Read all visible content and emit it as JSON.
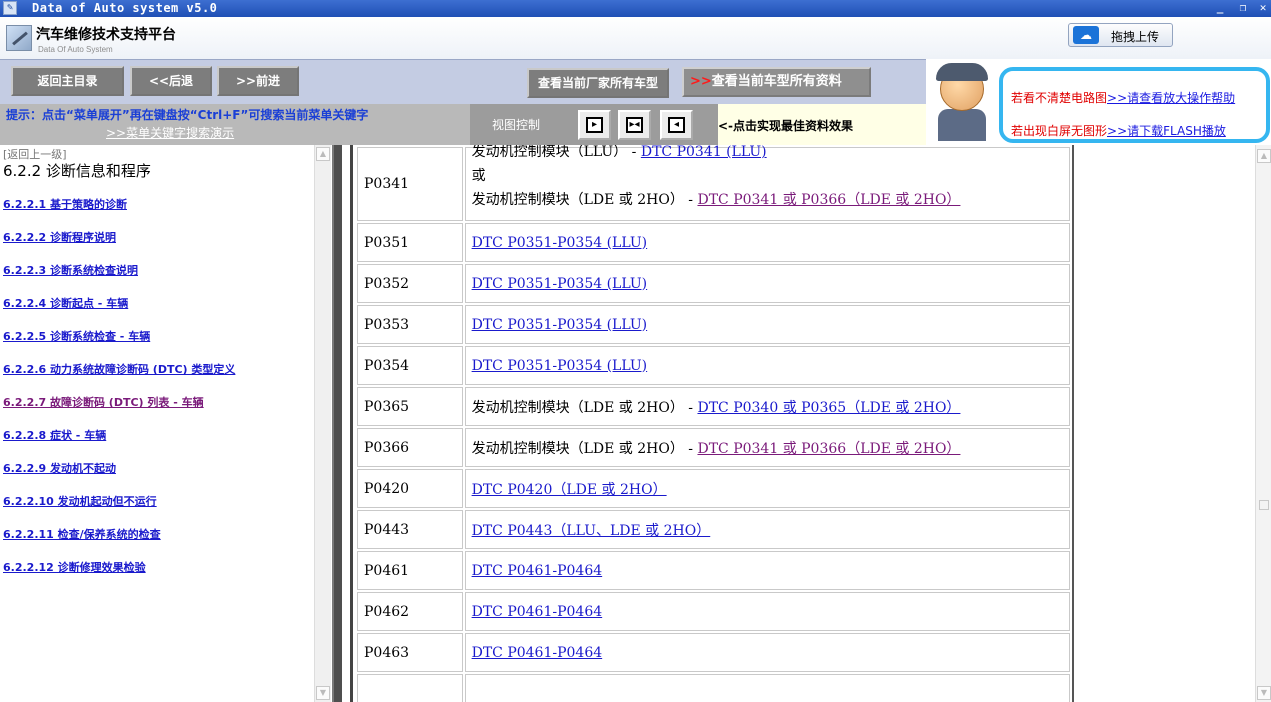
{
  "window": {
    "title": "Data of Auto system v5.0"
  },
  "header": {
    "brand": "汽车维修技术支持平台",
    "subtitle": "Data Of Auto System",
    "upload_label": "拖拽上传"
  },
  "nav": {
    "home": "返回主目录",
    "back": "<<后退",
    "forward": ">>前进",
    "maker_models": "查看当前厂家所有车型",
    "model_all_prefix": ">>",
    "model_all": "查看当前车型所有资料",
    "hint": "提示：点击“菜单展开”再在键盘按“Ctrl+F”可搜索当前菜单关键字",
    "hint_link": ">>菜单关键字搜索演示",
    "view_control": "视图控制",
    "best_tip": "<-点击实现最佳资料效果",
    "help1_text": "若看不清楚电路图",
    "help1_link": ">>请查看放大操作帮助",
    "help2_text": "若出现白屏无图形",
    "help2_link": ">>请下载FLASH播放"
  },
  "left": {
    "back_link": "[返回上一级]",
    "section": "6.2.2 诊断信息和程序",
    "items": [
      "6.2.2.1 基于策略的诊断",
      "6.2.2.2 诊断程序说明",
      "6.2.2.3 诊断系统检查说明",
      "6.2.2.4 诊断起点 - 车辆",
      "6.2.2.5 诊断系统检查 - 车辆",
      "6.2.2.6 动力系统故障诊断码 (DTC) 类型定义",
      "6.2.2.7 故障诊断码 (DTC) 列表 - 车辆",
      "6.2.2.8 症状 - 车辆",
      "6.2.2.9 发动机不起动",
      "6.2.2.10 发动机起动但不运行",
      "6.2.2.11 检查/保养系统的检查",
      "6.2.2.12 诊断修理效果检验"
    ]
  },
  "table": {
    "rows": [
      {
        "code": "P0341",
        "l1_text": "发动机控制模块（LLU） - ",
        "l1_link": "DTC P0341 (LLU)",
        "or": "或",
        "l3_text": "发动机控制模块（LDE 或 2HO） - ",
        "l3_link": "DTC P0341 或 P0366（LDE 或 2HO）"
      },
      {
        "code": "P0351",
        "link": "DTC P0351-P0354 (LLU)"
      },
      {
        "code": "P0352",
        "link": "DTC P0351-P0354 (LLU)"
      },
      {
        "code": "P0353",
        "link": "DTC P0351-P0354 (LLU)"
      },
      {
        "code": "P0354",
        "link": "DTC P0351-P0354 (LLU)"
      },
      {
        "code": "P0365",
        "text": "发动机控制模块（LDE 或 2HO） - ",
        "link": "DTC P0340 或 P0365（LDE 或 2HO）"
      },
      {
        "code": "P0366",
        "text": "发动机控制模块（LDE 或 2HO） - ",
        "link": "DTC P0341 或 P0366（LDE 或 2HO）"
      },
      {
        "code": "P0420",
        "link": "DTC P0420（LDE 或 2HO）"
      },
      {
        "code": "P0443",
        "link": "DTC P0443（LLU、LDE 或 2HO）"
      },
      {
        "code": "P0461",
        "link": "DTC P0461-P0464"
      },
      {
        "code": "P0462",
        "link": "DTC P0461-P0464"
      },
      {
        "code": "P0463",
        "link": "DTC P0461-P0464"
      }
    ]
  }
}
